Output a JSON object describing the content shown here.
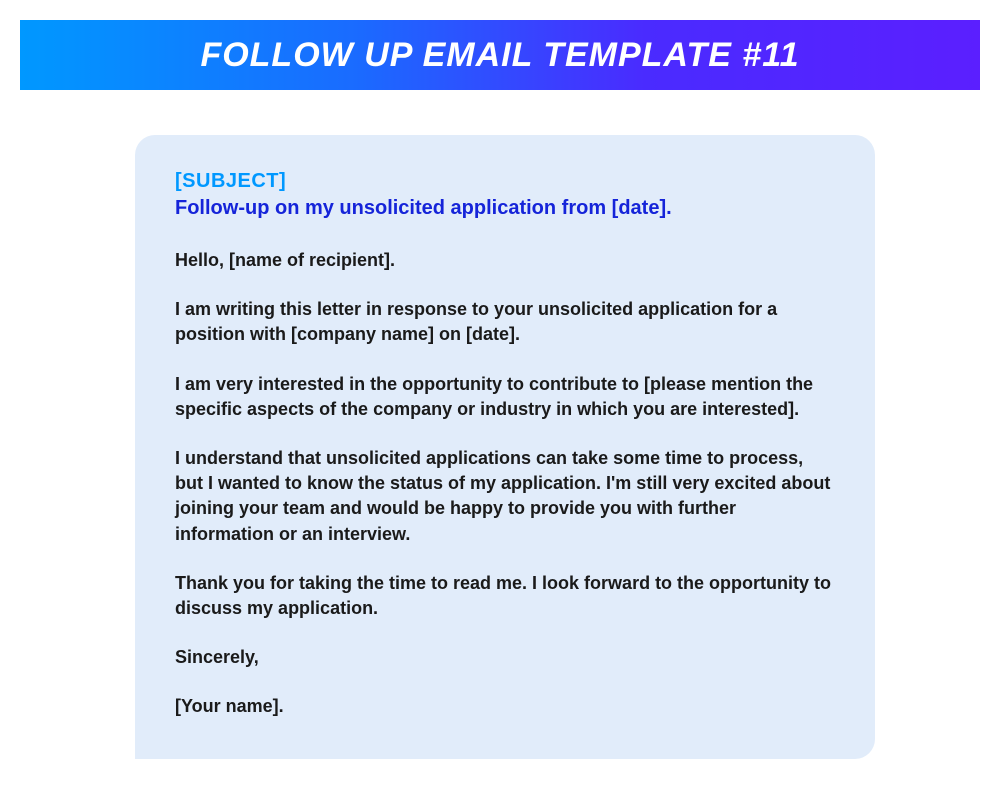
{
  "header": {
    "title": "FOLLOW UP EMAIL TEMPLATE #11"
  },
  "email": {
    "subject_label": "[SUBJECT]",
    "subject_line": "Follow-up on my unsolicited application from [date].",
    "greeting": "Hello, [name of recipient].",
    "paragraph1": "I am writing this letter in response to your unsolicited application for a position with [company name] on [date].",
    "paragraph2": "I am very interested in the opportunity to contribute to [please mention the specific aspects of the company or industry in which you are interested].",
    "paragraph3": "I understand that unsolicited applications can take some time to process, but I wanted to know the status of my application. I'm still very excited about joining your team and would be happy to provide you with further information or an interview.",
    "paragraph4": "Thank you for taking the time to read me. I look forward to the opportunity to discuss my application.",
    "signoff": "Sincerely,",
    "signature": "[Your name]."
  }
}
